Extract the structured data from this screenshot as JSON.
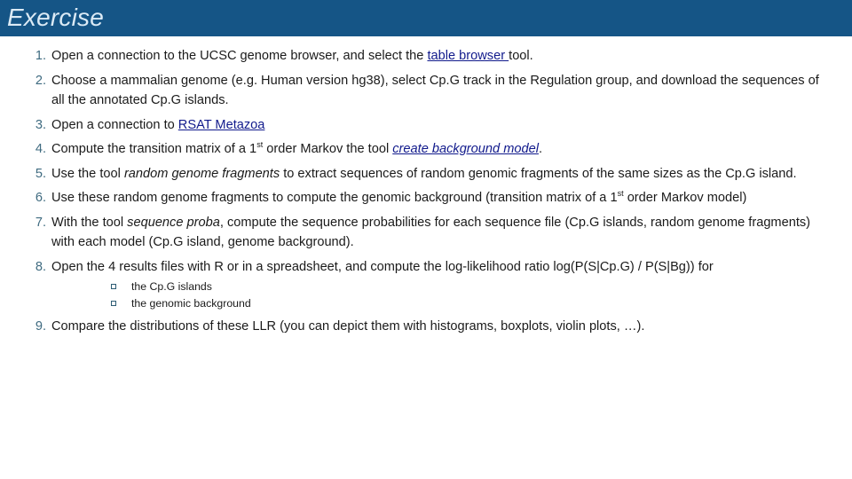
{
  "slide": {
    "title": "Exercise",
    "header_color": "#155586",
    "title_color": "#dbeaf5",
    "number_color": "#3f6b80",
    "link_color": "#111a8c",
    "bullet_marker_color": "#2d5c74"
  },
  "items": [
    {
      "number": "1.",
      "runs": [
        {
          "kind": "text",
          "text": "Open a connection to the UCSC genome browser, and select the "
        },
        {
          "kind": "link",
          "text": "table browser "
        },
        {
          "kind": "text",
          "text": "tool."
        }
      ]
    },
    {
      "number": "2.",
      "runs": [
        {
          "kind": "text",
          "text": "Choose a mammalian genome (e.g. Human version hg38), select Cp.G track in the Regulation group, and download the sequences of all the annotated Cp.G islands."
        }
      ]
    },
    {
      "number": "3.",
      "runs": [
        {
          "kind": "text",
          "text": " Open a connection to "
        },
        {
          "kind": "link",
          "text": "RSAT Metazoa"
        }
      ]
    },
    {
      "number": "4.",
      "runs": [
        {
          "kind": "text",
          "text": "Compute the transition matrix of a 1"
        },
        {
          "kind": "sup",
          "text": "st"
        },
        {
          "kind": "text",
          "text": " order Markov the tool "
        },
        {
          "kind": "link-italic",
          "text": "create background model"
        },
        {
          "kind": "text",
          "text": "."
        }
      ]
    },
    {
      "number": "5.",
      "runs": [
        {
          "kind": "text",
          "text": "Use the tool "
        },
        {
          "kind": "italic",
          "text": "random genome fragments"
        },
        {
          "kind": "text",
          "text": " to extract sequences of random genomic fragments of the same sizes as the Cp.G island."
        }
      ]
    },
    {
      "number": "6.",
      "runs": [
        {
          "kind": "text",
          "text": "Use these random genome fragments to compute the genomic background (transition matrix of a 1"
        },
        {
          "kind": "sup",
          "text": "st"
        },
        {
          "kind": "text",
          "text": " order Markov model)"
        }
      ]
    },
    {
      "number": "7.",
      "runs": [
        {
          "kind": "text",
          "text": "With the tool "
        },
        {
          "kind": "italic",
          "text": "sequence proba"
        },
        {
          "kind": "text",
          "text": ", compute the sequence probabilities for each sequence file (Cp.G islands, random genome fragments) with each model (Cp.G island, genome background)."
        }
      ]
    },
    {
      "number": "8.",
      "runs": [
        {
          "kind": "text",
          "text": "Open the 4 results files with R or in a spreadsheet, and compute the log-likelihood ratio log(P(S|Cp.G) / P(S|Bg)) for"
        }
      ],
      "sub_items": [
        "the Cp.G islands",
        "the genomic background"
      ]
    },
    {
      "number": "9.",
      "runs": [
        {
          "kind": "text",
          "text": "Compare the distributions of these LLR (you can depict them with histograms, boxplots, violin plots, …)."
        }
      ]
    }
  ]
}
